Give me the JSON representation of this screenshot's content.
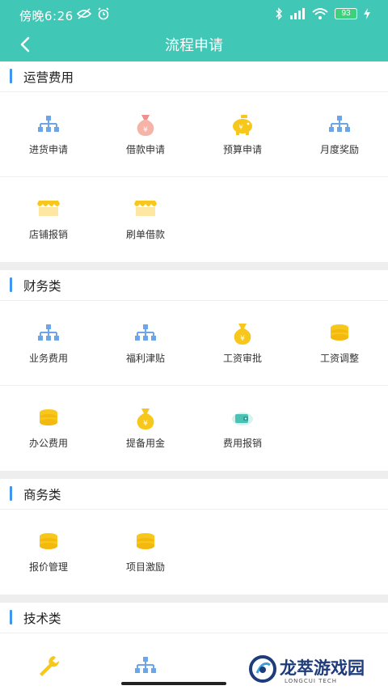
{
  "status": {
    "time": "傍晚6:26",
    "battery": "93"
  },
  "header": {
    "title": "流程申请"
  },
  "sections": [
    {
      "title": "运营费用",
      "items": [
        {
          "label": "进货申请",
          "icon": "org-chart-icon"
        },
        {
          "label": "借款申请",
          "icon": "money-bag-pink-icon"
        },
        {
          "label": "预算申请",
          "icon": "piggy-bank-icon"
        },
        {
          "label": "月度奖励",
          "icon": "org-chart-icon"
        },
        {
          "label": "店铺报销",
          "icon": "shop-awning-icon"
        },
        {
          "label": "刷单借款",
          "icon": "shop-awning-icon"
        }
      ]
    },
    {
      "title": "财务类",
      "items": [
        {
          "label": "业务费用",
          "icon": "org-chart-icon"
        },
        {
          "label": "福利津贴",
          "icon": "org-chart-icon"
        },
        {
          "label": "工资审批",
          "icon": "money-bag-icon"
        },
        {
          "label": "工资调整",
          "icon": "coin-stack-icon"
        },
        {
          "label": "办公费用",
          "icon": "coin-stack-icon"
        },
        {
          "label": "提备用金",
          "icon": "money-bag-icon"
        },
        {
          "label": "费用报销",
          "icon": "wallet-icon"
        }
      ]
    },
    {
      "title": "商务类",
      "items": [
        {
          "label": "报价管理",
          "icon": "coin-stack-icon"
        },
        {
          "label": "项目激励",
          "icon": "coin-stack-icon"
        }
      ]
    },
    {
      "title": "技术类",
      "items": [
        {
          "label": "",
          "icon": "wrench-icon"
        },
        {
          "label": "",
          "icon": "org-chart-icon"
        }
      ]
    }
  ],
  "watermark": {
    "name": "龙萃游戏园",
    "sub": "LONGCUI TECH"
  },
  "colors": {
    "header": "#41c7b6",
    "accent_bar": "#3f95f0",
    "gold": "#f7c71b",
    "blue_icon": "#6ca6e8"
  }
}
